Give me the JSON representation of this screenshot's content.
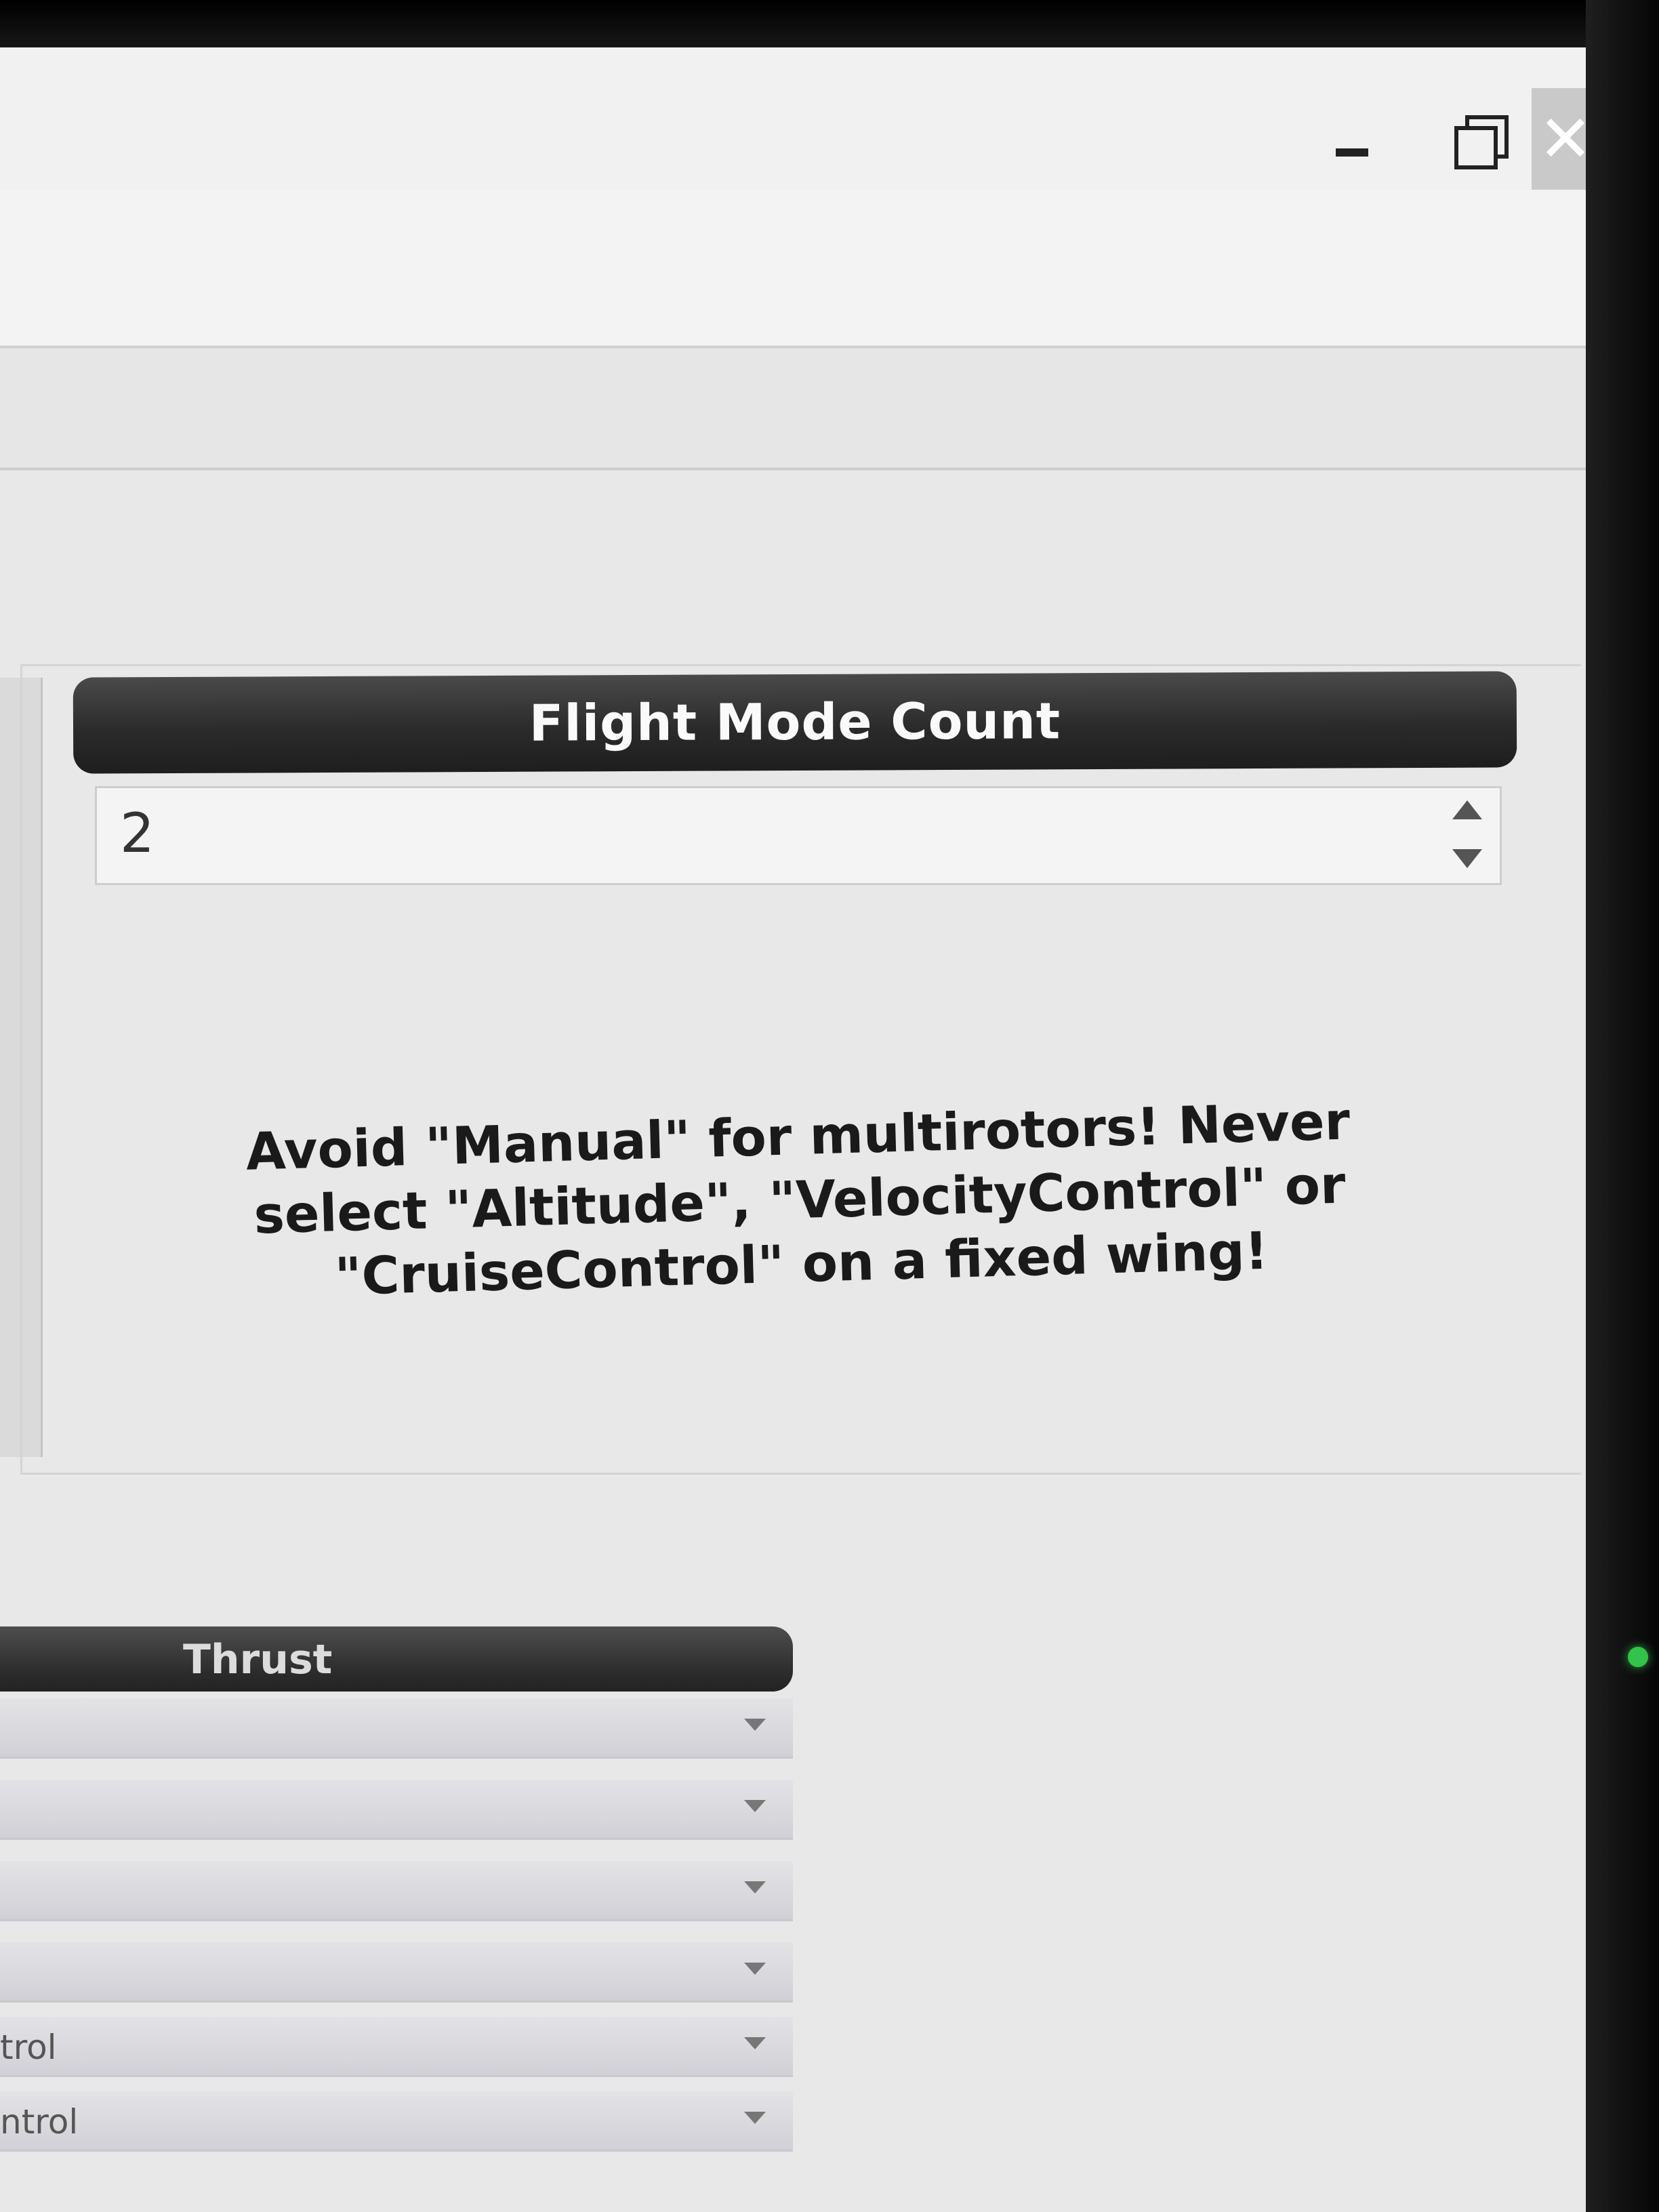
{
  "window": {
    "minimize_icon": "minimize-icon",
    "restore_icon": "restore-icon",
    "close_glyph": "✕"
  },
  "flight_mode": {
    "header": "Flight Mode Count",
    "count_value": "2",
    "warning": "Avoid \"Manual\" for multirotors! Never select \"Altitude\", \"VelocityControl\" or \"CruiseControl\" on a fixed wing!"
  },
  "thrust": {
    "header": "Thrust",
    "rows": [
      {
        "label": ""
      },
      {
        "label": ""
      },
      {
        "label": ""
      },
      {
        "label": ""
      },
      {
        "label": "trol"
      },
      {
        "label": "ntrol"
      }
    ]
  },
  "colors": {
    "header_bg": "#2b2b2b",
    "header_text": "#fafafa",
    "panel_bg": "#e8e8e8",
    "power_led": "#33c24a"
  }
}
